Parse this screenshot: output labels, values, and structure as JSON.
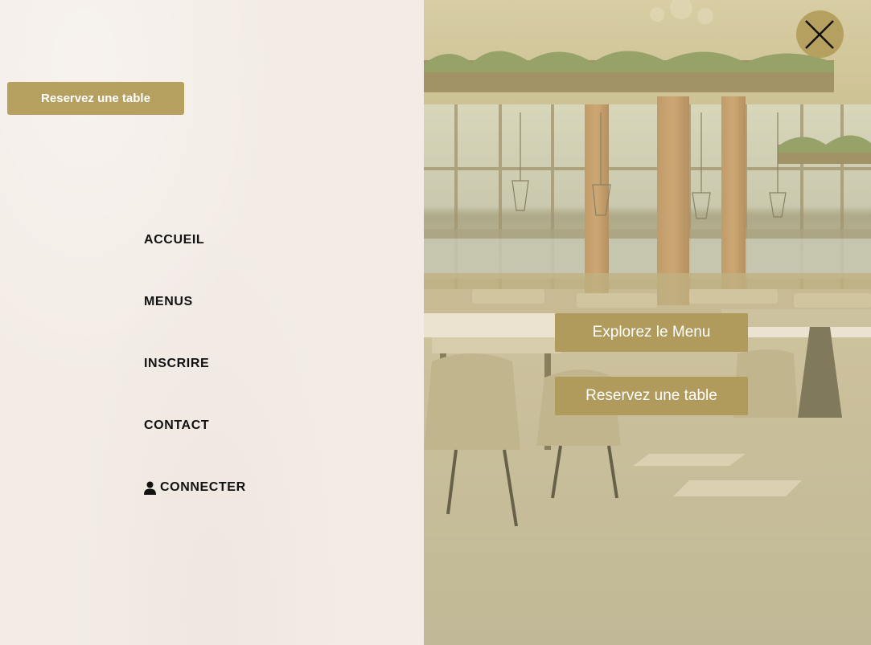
{
  "header": {
    "reserve_label": "Reservez une table"
  },
  "nav": {
    "items": [
      {
        "label": "ACCUEIL"
      },
      {
        "label": "MENUS"
      },
      {
        "label": "INSCRIRE"
      },
      {
        "label": "CONTACT"
      },
      {
        "label": "CONNECTER",
        "icon": "user-icon"
      }
    ]
  },
  "hero": {
    "explore_label": "Explorez le Menu",
    "reserve_label": "Reservez une table",
    "close_icon": "close-icon"
  },
  "colors": {
    "accent": "#b5a060",
    "panel_bg": "#f3ece6",
    "nav_text": "#111111",
    "button_text": "#ffffff"
  }
}
